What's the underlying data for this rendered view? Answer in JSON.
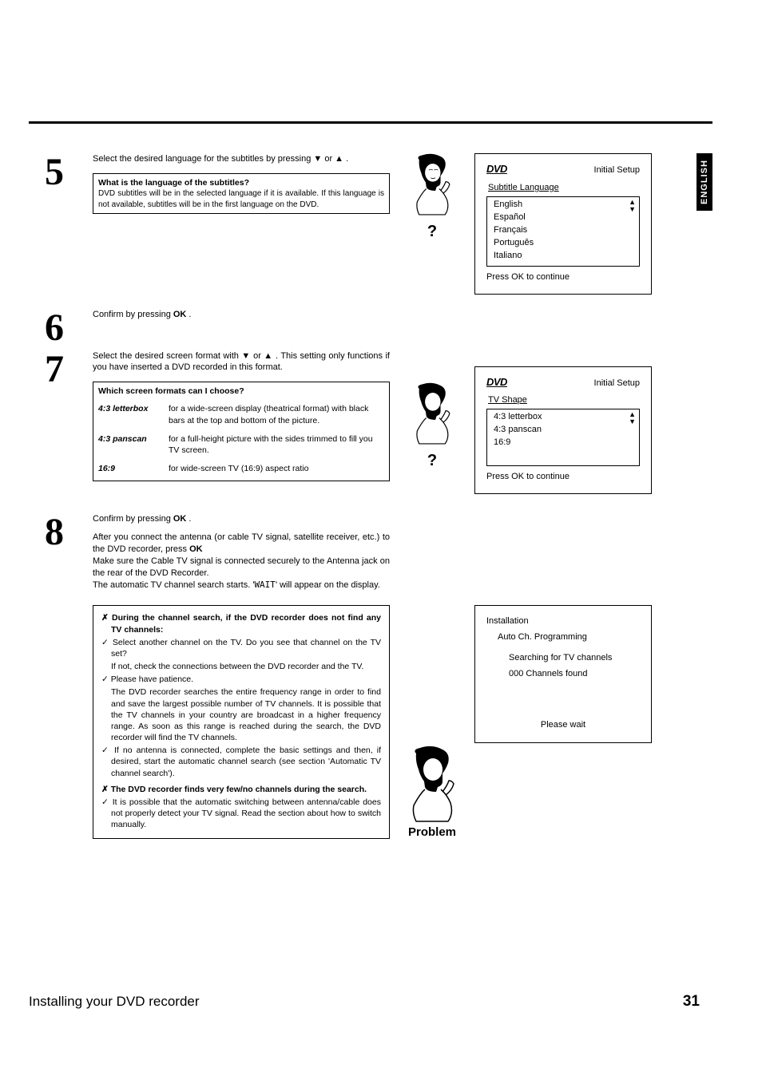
{
  "sidebar": {
    "language_tab": "ENGLISH"
  },
  "steps": {
    "s5": {
      "num": "5",
      "text": "Select the desired language for the subtitles by pressing ▼ or ▲ .",
      "box": {
        "title": "What is the language of the subtitles?",
        "body": "DVD subtitles will be in the selected language if it is available. If this language is not available, subtitles will be in the first language on the DVD."
      }
    },
    "s6": {
      "num": "6",
      "text_pre": "Confirm by pressing ",
      "ok": "OK",
      "text_post": " ."
    },
    "s7": {
      "num": "7",
      "text": "Select the desired screen format with ▼ or ▲ . This setting only functions if you have inserted a DVD recorded in this format.",
      "box": {
        "title": "Which screen formats can I choose?",
        "rows": [
          {
            "label": "4:3 letterbox",
            "desc": "for a wide-screen display (theatrical format) with black bars at the top and bottom of the picture."
          },
          {
            "label": "4:3 panscan",
            "desc": "for a full-height picture with the sides trimmed to fill you TV screen."
          },
          {
            "label": "16:9",
            "desc": "for wide-screen TV (16:9) aspect ratio"
          }
        ]
      }
    },
    "s8": {
      "num": "8",
      "text_pre": "Confirm by pressing ",
      "ok": "OK",
      "text_post": " .",
      "para2_pre": "After you connect the antenna (or cable TV signal, satellite receiver, etc.) to the DVD recorder, press ",
      "para2_ok": "OK",
      "para3": "Make sure the Cable TV signal is connected securely to the Antenna jack on the rear of the DVD Recorder.",
      "para4_pre": "The automatic TV channel search starts. '",
      "para4_wait": "WAIT",
      "para4_post": "' will appear on the display.",
      "trouble": {
        "t1": "During the channel search, if the DVD recorder does not find any TV channels:",
        "t1a": "Select another channel on the TV. Do you see that channel on the TV set?",
        "t1b": "If not, check the connections between the DVD recorder and the TV.",
        "t1c": "Please have patience.",
        "t1d": "The DVD recorder searches the entire frequency range in order to find and save the largest possible number of TV channels. It is possible that the TV channels in your country are broadcast in a higher frequency range. As soon as this range is reached during the search, the DVD recorder will find the TV channels.",
        "t1e": "If no antenna is connected, complete the basic settings and then, if desired, start the automatic channel search (see section 'Automatic TV channel search').",
        "t2": "The DVD recorder finds very few/no channels during the search.",
        "t2a": "It is possible that the automatic switching between antenna/cable does not properly detect your TV signal. Read the section about how to switch manually."
      },
      "problem_label": "Problem"
    }
  },
  "osd": {
    "logo": "DVD",
    "initial_setup": "Initial Setup",
    "continue": "Press OK to continue",
    "subtitle": {
      "title": "Subtitle Language",
      "items": [
        "English",
        "Español",
        "Français",
        "Português",
        "Italiano"
      ]
    },
    "tvshape": {
      "title": "TV Shape",
      "items": [
        "4:3 letterbox",
        "4:3 panscan",
        "16:9"
      ]
    },
    "install": {
      "title": "Installation",
      "sub": "Auto Ch. Programming",
      "line1": "Searching for TV channels",
      "line2": "000 Channels found",
      "wait": "Please wait"
    }
  },
  "footer": {
    "title": "Installing your DVD recorder",
    "page": "31"
  }
}
